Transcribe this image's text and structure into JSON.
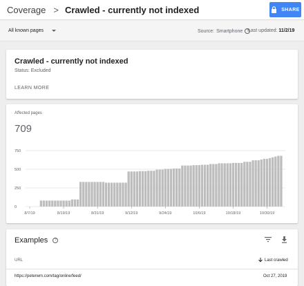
{
  "header": {
    "breadcrumb_root": "Coverage",
    "breadcrumb_separator": ">",
    "title": "Crawled - currently not indexed",
    "share_label": "SHARE"
  },
  "filters": {
    "pages_filter": "All known pages",
    "source_label": "Source:",
    "source_value": "Smartphone",
    "help_glyph": "?",
    "updated_label": "Last updated:",
    "updated_value": "11/2/19"
  },
  "status_card": {
    "title": "Crawled - currently not indexed",
    "status": "Status: Excluded",
    "learn_more": "LEARN MORE"
  },
  "chart_card": {
    "affected_label": "Affected pages",
    "affected_value": "709"
  },
  "chart_data": {
    "type": "bar",
    "title": "",
    "xlabel": "",
    "ylabel": "",
    "ylim": [
      0,
      750
    ],
    "yticks": [
      0,
      250,
      500,
      750
    ],
    "ytick_labels": [
      "0",
      "250",
      "500",
      "750"
    ],
    "xtick_labels": [
      "8/7/19",
      "8/19/19",
      "8/31/19",
      "9/12/19",
      "9/24/19",
      "10/6/19",
      "10/18/19",
      "10/30/19"
    ],
    "xtick_category_index": [
      0,
      12,
      24,
      36,
      48,
      60,
      72,
      84
    ],
    "grid": true,
    "bar_color": "#bdbdbd",
    "categories_count": 90,
    "values": [
      0,
      0,
      0,
      0,
      80,
      80,
      80,
      80,
      80,
      80,
      80,
      80,
      80,
      80,
      80,
      95,
      95,
      95,
      330,
      330,
      330,
      330,
      330,
      330,
      330,
      330,
      330,
      320,
      320,
      320,
      320,
      320,
      320,
      320,
      320,
      470,
      470,
      470,
      470,
      475,
      475,
      475,
      480,
      480,
      480,
      495,
      495,
      495,
      505,
      505,
      505,
      510,
      510,
      510,
      550,
      550,
      550,
      550,
      555,
      555,
      555,
      560,
      560,
      560,
      570,
      570,
      570,
      580,
      580,
      580,
      580,
      580,
      585,
      585,
      585,
      585,
      600,
      600,
      600,
      620,
      620,
      620,
      630,
      640,
      640,
      650,
      660,
      670,
      680,
      680
    ]
  },
  "examples": {
    "title": "Examples",
    "help_glyph": "?",
    "col_url": "URL",
    "col_last_crawled": "Last crawled",
    "rows": [
      {
        "url": "https://peterwm.com/tag/online/feed/",
        "last_crawled": "Oct 27, 2019"
      }
    ]
  },
  "colors": {
    "accent": "#4285f4",
    "bar": "#bdbdbd",
    "background": "#eeeeee"
  },
  "icons": {
    "share": "lock-icon",
    "filter": "filter-icon",
    "download": "download-icon",
    "sort": "arrow-down-icon",
    "help": "help-icon",
    "dropdown": "caret-down-icon"
  }
}
